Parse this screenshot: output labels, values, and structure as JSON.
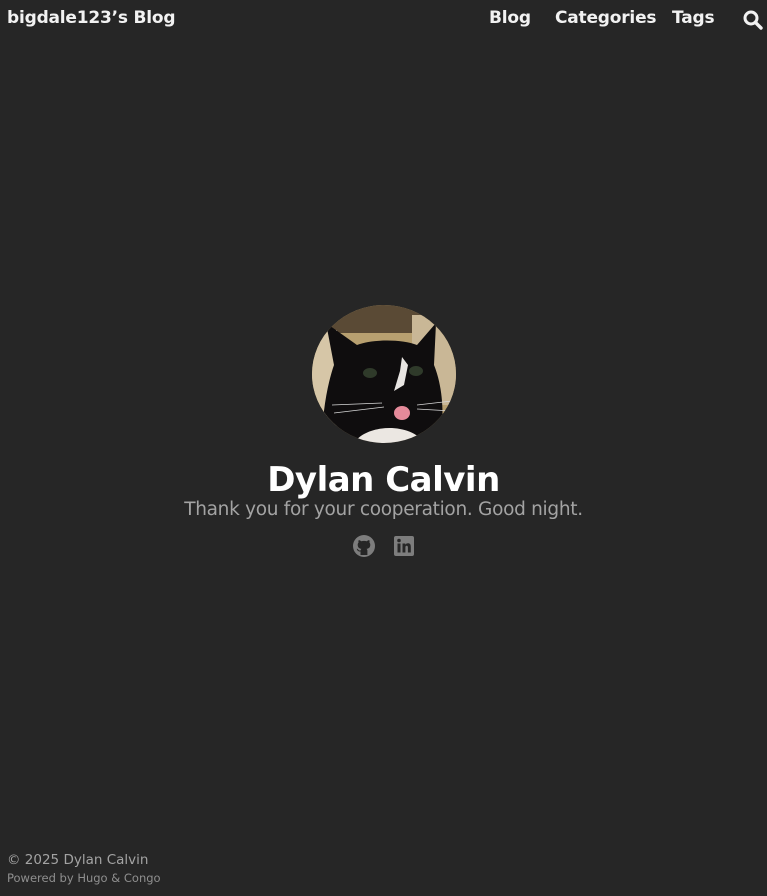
{
  "header": {
    "site_title": "bigdale123’s Blog",
    "nav": [
      "Blog",
      "Categories",
      "Tags"
    ],
    "search_icon": "search-icon"
  },
  "profile": {
    "avatar_icon": "avatar",
    "name": "Dylan Calvin",
    "tagline": "Thank you for your cooperation. Good night.",
    "social_icons": [
      "github-icon",
      "linkedin-icon"
    ]
  },
  "footer": {
    "copyright": "© 2025 Dylan Calvin",
    "powered_prefix": "Powered by",
    "powered_hugo": "Hugo",
    "powered_amp": "&",
    "powered_congo": "Congo"
  },
  "colors": {
    "background": "#262626",
    "text": "#f2f2f2",
    "muted": "#a3a3a3"
  }
}
